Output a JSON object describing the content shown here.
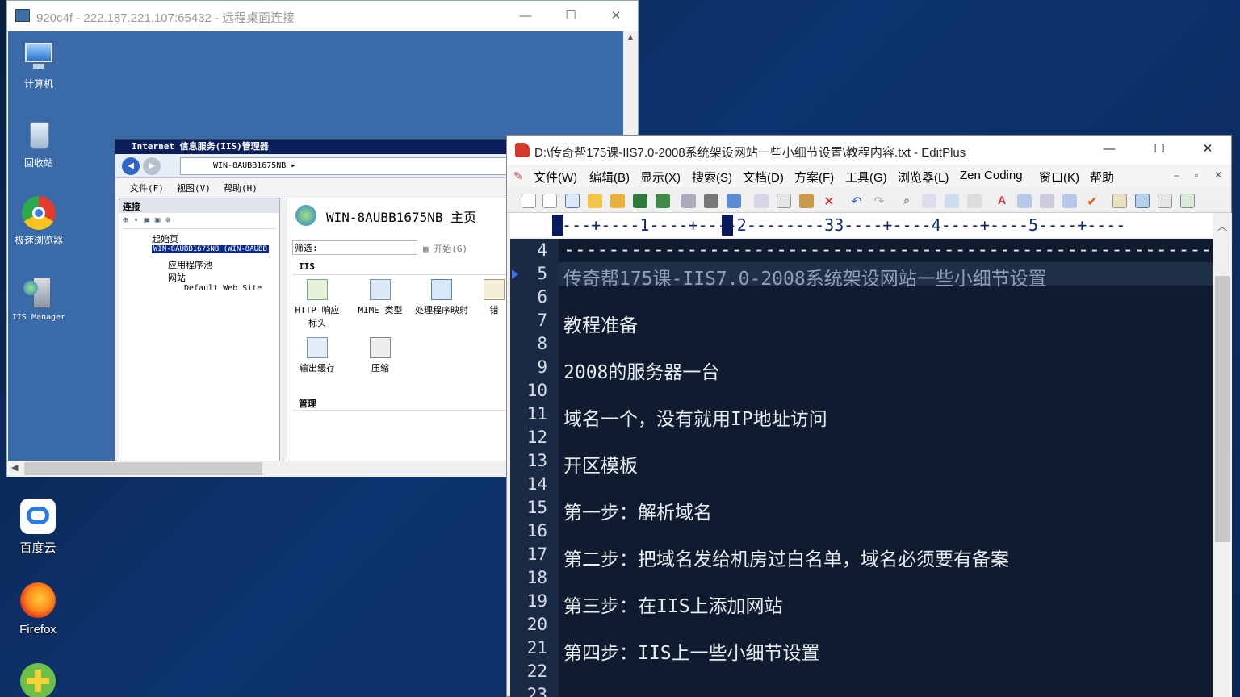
{
  "host": {
    "desktop_icons": [
      {
        "label": "百度云",
        "icon": "baidu-cloud-icon"
      },
      {
        "label": "Firefox",
        "icon": "firefox-icon"
      },
      {
        "label": "",
        "icon": "app-shortcut-icon"
      }
    ]
  },
  "rdp": {
    "title": "920c4f - 222.187.221.107:65432 - 远程桌面连接",
    "desktop_icons": [
      {
        "label": "计算机"
      },
      {
        "label": "回收站"
      },
      {
        "label": "极速浏览器"
      },
      {
        "label": "IIS Manager"
      }
    ]
  },
  "iis": {
    "title": "Internet 信息服务(IIS)管理器",
    "address": "WIN-8AUBB1675NB",
    "menu": [
      "文件(F)",
      "视图(V)",
      "帮助(H)"
    ],
    "connections_label": "连接",
    "tree": [
      "起始页",
      "WIN-8AUBB1675NB (WIN-8AUBB",
      "应用程序池",
      "网站",
      "Default Web Site"
    ],
    "home_title": "WIN-8AUBB1675NB 主页",
    "filter_label": "筛选:",
    "start_label": "开始(G)",
    "group_iis": "IIS",
    "features": [
      "HTTP 响应标头",
      "MIME 类型",
      "处理程序映射",
      "错",
      "输出缓存",
      "压缩"
    ],
    "group_manage": "管理"
  },
  "editplus": {
    "title": "D:\\传奇帮175课-IIS7.0-2008系统架设网站一些小细节设置\\教程内容.txt - EditPlus",
    "menu": [
      "文件(W)",
      "编辑(B)",
      "显示(X)",
      "搜索(S)",
      "文档(D)",
      "方案(F)",
      "工具(G)",
      "浏览器(L)",
      "Zen Coding",
      "窗口(K)",
      "帮助"
    ],
    "ruler": "----+----1----+----2--------33----+----4----+----5----+----",
    "lines": [
      {
        "n": "4",
        "text": "------------------------------------------------------------"
      },
      {
        "n": "5",
        "text": "传奇帮175课-IIS7.0-2008系统架设网站一些小细节设置"
      },
      {
        "n": "6",
        "text": ""
      },
      {
        "n": "7",
        "text": "教程准备"
      },
      {
        "n": "8",
        "text": ""
      },
      {
        "n": "9",
        "text": "2008的服务器一台"
      },
      {
        "n": "10",
        "text": ""
      },
      {
        "n": "11",
        "text": "域名一个，没有就用IP地址访问"
      },
      {
        "n": "12",
        "text": ""
      },
      {
        "n": "13",
        "text": "开区模板"
      },
      {
        "n": "14",
        "text": ""
      },
      {
        "n": "15",
        "text": "第一步：解析域名"
      },
      {
        "n": "16",
        "text": ""
      },
      {
        "n": "17",
        "text": "第二步：把域名发给机房过白名单，域名必须要有备案"
      },
      {
        "n": "18",
        "text": ""
      },
      {
        "n": "19",
        "text": "第三步：在IIS上添加网站"
      },
      {
        "n": "20",
        "text": ""
      },
      {
        "n": "21",
        "text": "第四步：IIS上一些小细节设置"
      },
      {
        "n": "22",
        "text": ""
      },
      {
        "n": "23",
        "text": ""
      }
    ]
  }
}
